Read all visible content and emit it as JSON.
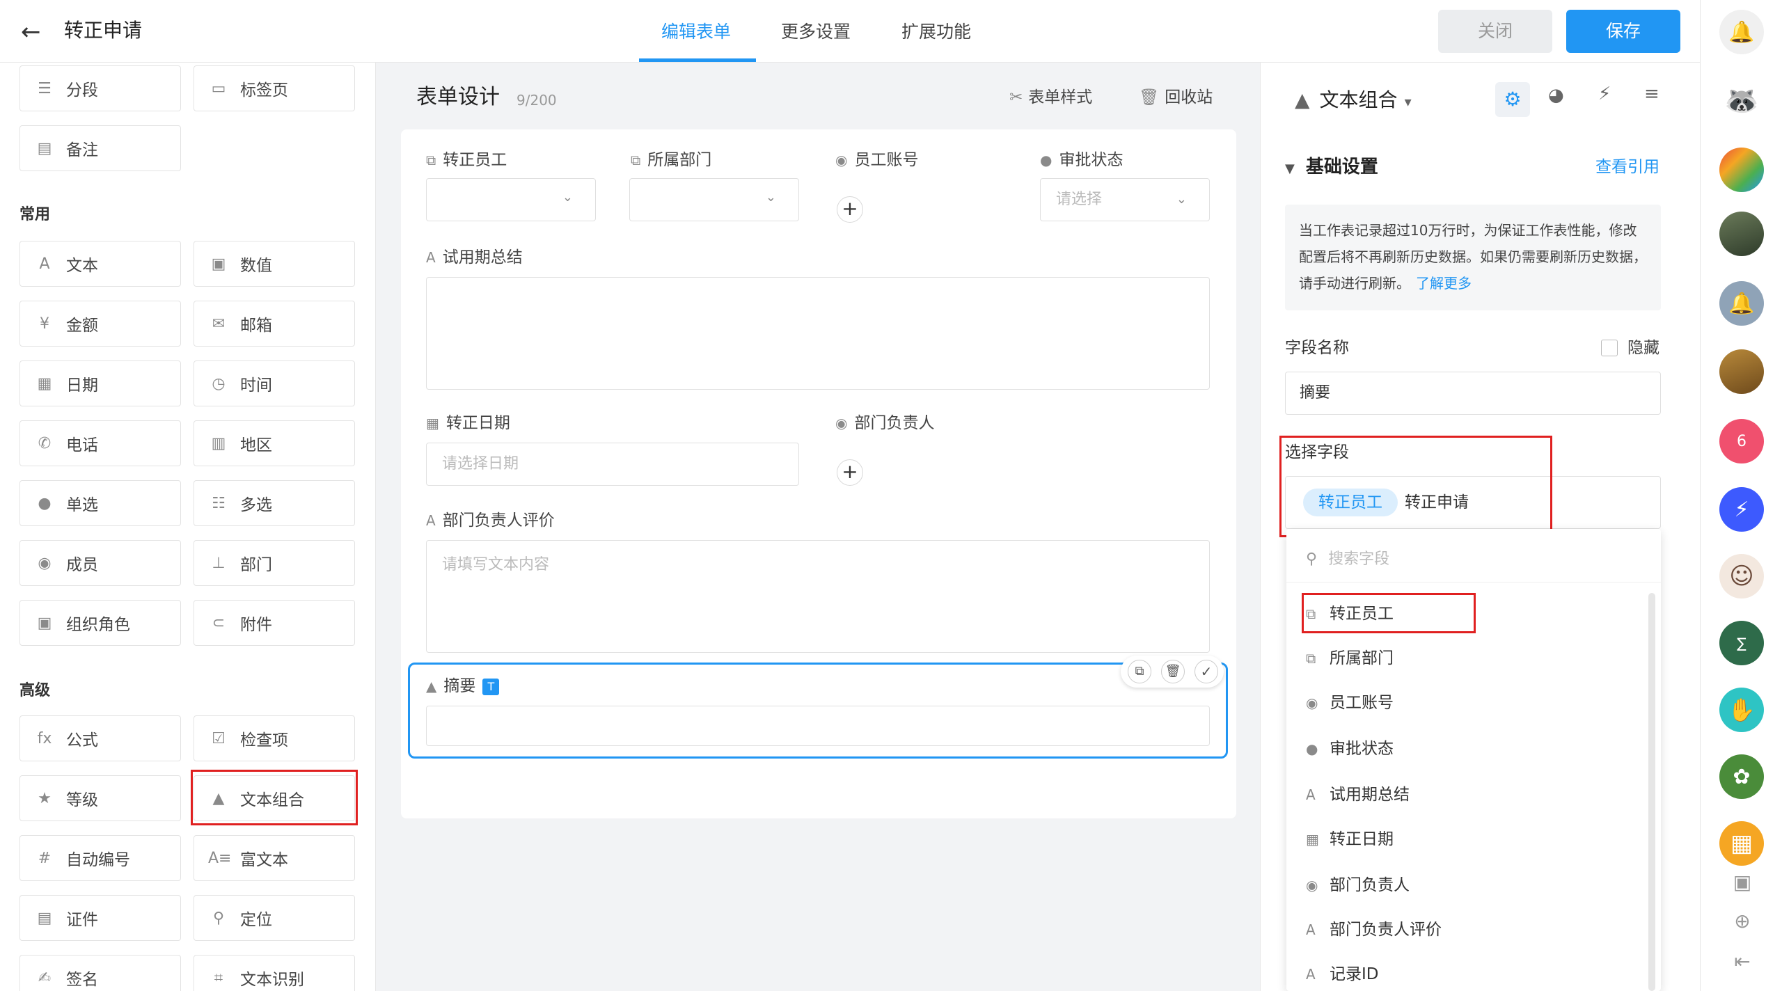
{
  "header": {
    "title": "转正申请",
    "tabs": [
      "编辑表单",
      "更多设置",
      "扩展功能"
    ],
    "close_label": "关闭",
    "save_label": "保存"
  },
  "left": {
    "top_items": [
      "分段",
      "标签页",
      "备注"
    ],
    "common_title": "常用",
    "common_items": [
      "文本",
      "数值",
      "金额",
      "邮箱",
      "日期",
      "时间",
      "电话",
      "地区",
      "单选",
      "多选",
      "成员",
      "部门",
      "组织角色",
      "附件"
    ],
    "advanced_title": "高级",
    "advanced_items": [
      "公式",
      "检查项",
      "等级",
      "文本组合",
      "自动编号",
      "富文本",
      "证件",
      "定位",
      "签名",
      "文本识别"
    ]
  },
  "middle": {
    "title": "表单设计",
    "count": "9/200",
    "style_label": "表单样式",
    "recycle_label": "回收站",
    "fields": {
      "employee": "转正员工",
      "department": "所属部门",
      "account": "员工账号",
      "status": "审批状态",
      "status_placeholder": "请选择",
      "summary": "试用期总结",
      "date": "转正日期",
      "date_placeholder": "请选择日期",
      "manager": "部门负责人",
      "review": "部门负责人评价",
      "review_placeholder": "请填写文本内容",
      "abstract": "摘要",
      "abstract_badge": "T"
    }
  },
  "right": {
    "type_title": "文本组合",
    "section": "基础设置",
    "view_ref": "查看引用",
    "notice": "当工作表记录超过10万行时，为保证工作表性能，修改配置后将不再刷新历史数据。如果仍需要刷新历史数据，请手动进行刷新。",
    "learn_more": "了解更多",
    "field_name_label": "字段名称",
    "hide_label": "隐藏",
    "field_name_value": "摘要",
    "select_field_label": "选择字段",
    "chip": "转正员工",
    "chip_text": "转正申请",
    "search_placeholder": "搜索字段",
    "dropdown": [
      "转正员工",
      "所属部门",
      "员工账号",
      "审批状态",
      "试用期总结",
      "转正日期",
      "部门负责人",
      "部门负责人评价",
      "记录ID"
    ]
  },
  "rail": {
    "calendar_day": "6"
  },
  "colors": {
    "accent": "#2196f3",
    "highlight": "#e02020"
  }
}
